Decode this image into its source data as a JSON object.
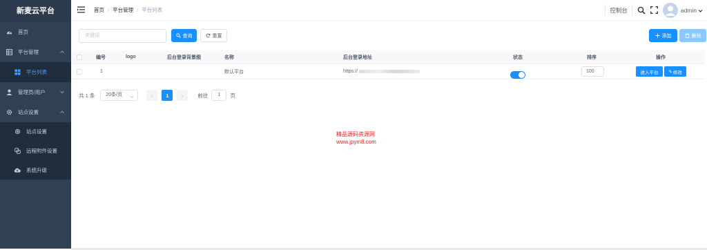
{
  "sidebar": {
    "logo": "新麦云平台",
    "items": [
      {
        "label": "首页"
      },
      {
        "label": "平台管理"
      },
      {
        "label": "平台列表"
      },
      {
        "label": "管理员/用户"
      },
      {
        "label": "站点设置"
      },
      {
        "label": "站点设置"
      },
      {
        "label": "远程附件设置"
      },
      {
        "label": "系统升级"
      }
    ]
  },
  "header": {
    "breadcrumb": [
      "首页",
      "平台管理",
      "平台列表"
    ],
    "console": "控制台",
    "user": "admin"
  },
  "toolbar": {
    "search_placeholder": "关键词",
    "query_label": "查询",
    "reset_label": "重置",
    "add_label": "添加",
    "delete_label": "删除"
  },
  "table": {
    "columns": [
      "编号",
      "logo",
      "后台登录背景图",
      "名称",
      "后台登录地址",
      "状态",
      "排序",
      "操作"
    ],
    "rows": [
      {
        "id": "1",
        "name": "默认平台",
        "url": "https://",
        "status_on": true,
        "sort": "100",
        "enter_label": "进入平台",
        "edit_label": "修改"
      }
    ]
  },
  "pagination": {
    "total": "共 1 条",
    "page_size": "20条/页",
    "current_page": "1",
    "goto_label": "前往",
    "goto_value": "1",
    "page_unit": "页"
  },
  "watermark": {
    "line1": "精品源码资源网",
    "line2": "www.jpym8.com"
  },
  "colors": {
    "sidebar_bg": "#304156",
    "primary": "#1890ff",
    "active_menu": "#409eff"
  }
}
